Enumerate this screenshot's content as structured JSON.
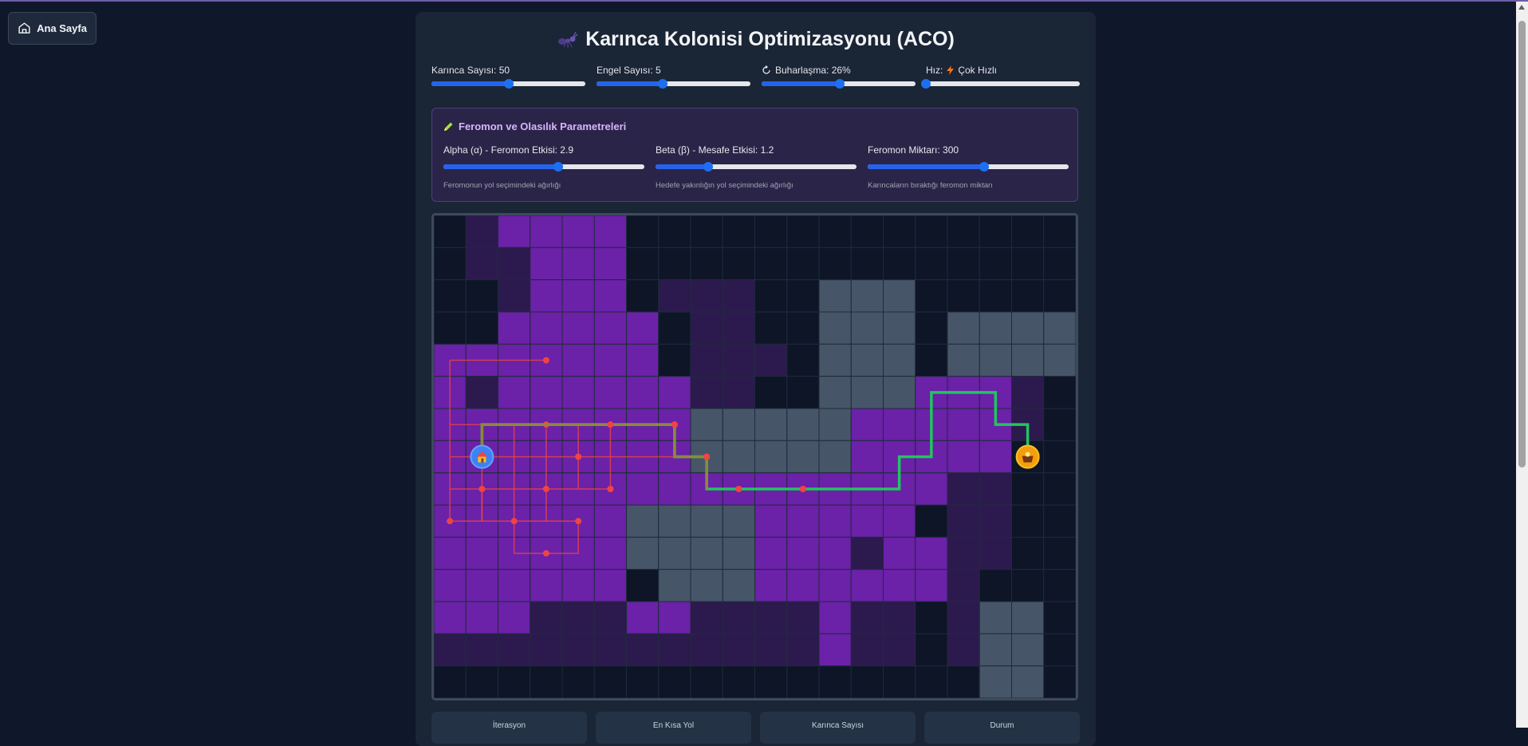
{
  "nav": {
    "home_label": "Ana Sayfa"
  },
  "app": {
    "title": "Karınca Kolonisi Optimizasyonu (ACO)"
  },
  "controls": {
    "ant_count": {
      "label": "Karınca Sayısı: 50",
      "value": 50,
      "fraction": 0.5
    },
    "obstacle_count": {
      "label": "Engel Sayısı: 5",
      "value": 5,
      "fraction": 0.43
    },
    "evaporation": {
      "label": "Buharlaşma: 26%",
      "value": 26,
      "fraction": 0.51
    },
    "speed": {
      "label_prefix": "Hız:",
      "label_value": "Çok Hızlı",
      "fraction": 0.0
    }
  },
  "params": {
    "title": "Feromon ve Olasılık Parametreleri",
    "alpha": {
      "label": "Alpha (α) - Feromon Etkisi: 2.9",
      "value": 2.9,
      "fraction": 0.57,
      "hint": "Feromonun yol seçimindeki ağırlığı"
    },
    "beta": {
      "label": "Beta (β) - Mesafe Etkisi: 1.2",
      "value": 1.2,
      "fraction": 0.26,
      "hint": "Hedefe yakınlığın yol seçimindeki ağırlığı"
    },
    "pheromone_amount": {
      "label": "Feromon Miktarı: 300",
      "value": 300,
      "fraction": 0.58,
      "hint": "Karıncaların bıraktığı feromon miktarı"
    }
  },
  "stats": {
    "labels": [
      "İterasyon",
      "En Kısa Yol",
      "Karınca Sayısı",
      "Durum"
    ]
  },
  "colors": {
    "accent": "#2563eb",
    "best_path": "#22c55e",
    "ant_trail": "#ef4444",
    "pheromone": "#6b21a8",
    "obstacle": "#475569",
    "nest": "#3b82f6",
    "food": "#f59e0b"
  },
  "grid": {
    "size": 20,
    "rows": [
      "01222200000000000000",
      "01122200000000000000",
      "00122201110033300000",
      "00222220110033303333",
      "22222220111033303333",
      "21222222110033322210",
      "22222222333332222210",
      "22222222333332222200",
      "22222222222222221100",
      "22222233332222201100",
      "22222233332221221100",
      "22222203332222221000",
      "22211122111121101330",
      "11111111111121101330",
      "00000000000000000330"
    ],
    "nest": {
      "col": 1,
      "row": 7,
      "icon": "house-icon"
    },
    "food": {
      "col": 18,
      "row": 7,
      "icon": "basket-icon"
    },
    "best_path": [
      [
        1,
        7
      ],
      [
        1,
        6
      ],
      [
        7,
        6
      ],
      [
        7,
        7
      ],
      [
        8,
        7
      ],
      [
        8,
        8
      ],
      [
        14,
        8
      ],
      [
        14,
        7
      ],
      [
        15,
        7
      ],
      [
        15,
        5
      ],
      [
        17,
        5
      ],
      [
        17,
        6
      ],
      [
        18,
        6
      ],
      [
        18,
        7
      ]
    ],
    "trail_dots": [
      [
        3,
        4
      ],
      [
        1,
        7
      ],
      [
        3,
        6
      ],
      [
        5,
        6
      ],
      [
        7,
        6
      ],
      [
        4,
        7
      ],
      [
        8,
        7
      ],
      [
        1,
        8
      ],
      [
        3,
        8
      ],
      [
        5,
        8
      ],
      [
        0,
        9
      ],
      [
        2,
        9
      ],
      [
        4,
        9
      ],
      [
        3,
        10
      ],
      [
        9,
        8
      ],
      [
        11,
        8
      ]
    ],
    "trails": [
      [
        [
          0,
          4
        ],
        [
          3,
          4
        ]
      ],
      [
        [
          0,
          4
        ],
        [
          0,
          9
        ],
        [
          4,
          9
        ]
      ],
      [
        [
          0,
          6
        ],
        [
          5,
          6
        ]
      ],
      [
        [
          0,
          7
        ],
        [
          8,
          7
        ]
      ],
      [
        [
          0,
          8
        ],
        [
          5,
          8
        ]
      ],
      [
        [
          1,
          6
        ],
        [
          1,
          9
        ]
      ],
      [
        [
          2,
          6
        ],
        [
          2,
          10
        ],
        [
          4,
          10
        ],
        [
          4,
          9
        ]
      ],
      [
        [
          3,
          6
        ],
        [
          3,
          9
        ]
      ],
      [
        [
          4,
          6
        ],
        [
          4,
          8
        ]
      ],
      [
        [
          5,
          6
        ],
        [
          5,
          8
        ]
      ],
      [
        [
          7,
          6
        ],
        [
          7,
          7
        ]
      ],
      [
        [
          1,
          9
        ],
        [
          1,
          8
        ]
      ]
    ]
  }
}
